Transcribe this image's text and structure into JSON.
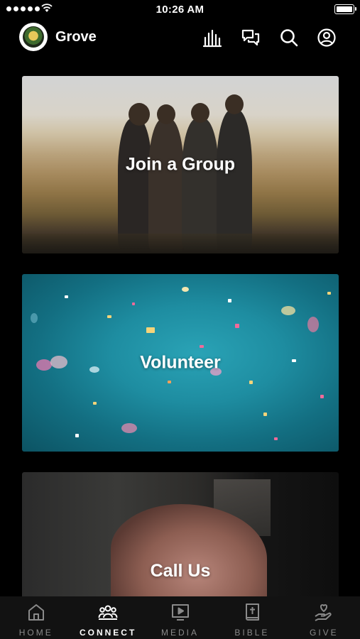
{
  "status_bar": {
    "time": "10:26 AM"
  },
  "header": {
    "title": "Grove"
  },
  "cards": [
    {
      "label": "Join a Group"
    },
    {
      "label": "Volunteer"
    },
    {
      "label": "Call Us"
    }
  ],
  "tabs": [
    {
      "label": "HOME",
      "icon": "home-icon"
    },
    {
      "label": "CONNECT",
      "icon": "people-icon",
      "active": true
    },
    {
      "label": "MEDIA",
      "icon": "play-screen-icon"
    },
    {
      "label": "BIBLE",
      "icon": "bible-icon"
    },
    {
      "label": "GIVE",
      "icon": "give-hand-heart-icon"
    }
  ],
  "colors": {
    "background": "#000000",
    "tab_bar": "#121212",
    "inactive_tab": "#8a8a8a",
    "text": "#ffffff"
  }
}
